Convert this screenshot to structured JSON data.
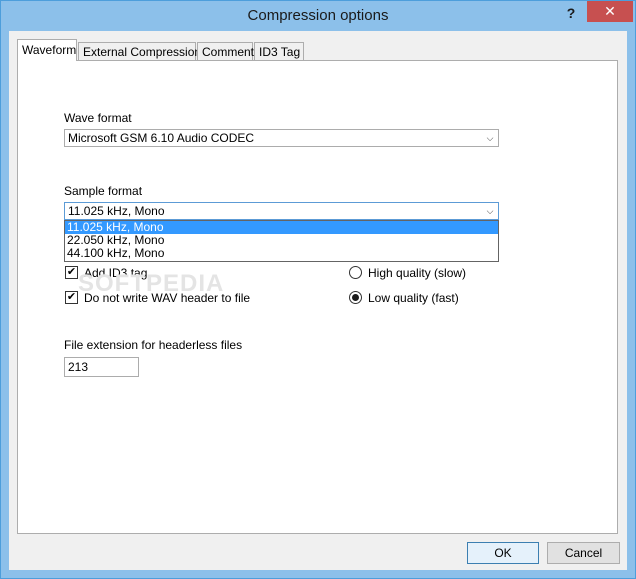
{
  "window": {
    "title": "Compression options",
    "help_label": "?",
    "close_label": "✕"
  },
  "tabs": [
    {
      "label": "Waveform"
    },
    {
      "label": "External Compression"
    },
    {
      "label": "Comment"
    },
    {
      "label": "ID3 Tag"
    }
  ],
  "wave_format": {
    "label": "Wave format",
    "value": "Microsoft GSM 6.10 Audio CODEC"
  },
  "sample_format": {
    "label": "Sample format",
    "value": "11.025 kHz, Mono",
    "options": [
      "11.025 kHz, Mono",
      "22.050 kHz, Mono",
      "44.100 kHz, Mono"
    ]
  },
  "options": {
    "add_id3_label": "Add ID3 tag",
    "no_wav_header_label": "Do not write WAV header to file",
    "high_quality_label": "High quality (slow)",
    "low_quality_label": "Low quality (fast)"
  },
  "file_extension": {
    "label": "File extension for headerless files",
    "value": "213"
  },
  "buttons": {
    "ok": "OK",
    "cancel": "Cancel"
  },
  "icons": {
    "dropdown": "chevron-down-icon",
    "check": "✔"
  },
  "watermark": "SOFTPEDIA"
}
